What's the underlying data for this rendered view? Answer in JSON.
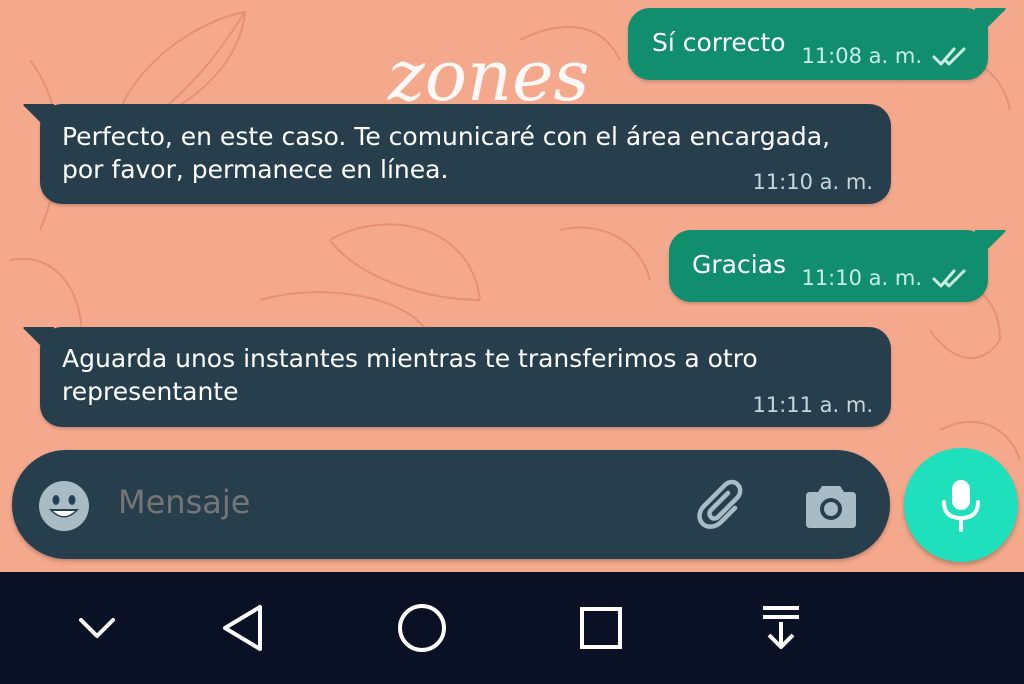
{
  "messages": [
    {
      "direction": "outgoing",
      "text": "Sí correcto",
      "time": "11:08 a. m.",
      "status": "read"
    },
    {
      "direction": "incoming",
      "text": "Perfecto, en este caso. Te comunicaré con el área encargada, por favor, permanece en línea.",
      "time": "11:10 a. m."
    },
    {
      "direction": "outgoing",
      "text": "Gracias",
      "time": "11:10 a. m.",
      "status": "read"
    },
    {
      "direction": "incoming",
      "text": "Aguarda unos instantes mientras te transferimos a otro representante",
      "time": "11:11 a. m."
    }
  ],
  "wallpaper": {
    "watermark_text": "zones"
  },
  "composer": {
    "placeholder": "Mensaje"
  },
  "icons": {
    "emoji": "emoji-icon",
    "attach": "paperclip-icon",
    "camera": "camera-icon",
    "mic": "mic-icon",
    "ticks": "double-check-icon"
  },
  "navbar": {
    "buttons": [
      "chevron-down-icon",
      "back-triangle-icon",
      "home-circle-icon",
      "recents-square-icon",
      "notification-pull-icon"
    ]
  },
  "colors": {
    "wallpaper": "#f4a98d",
    "outgoing_bubble": "#118e6e",
    "incoming_bubble": "#273f4d",
    "mic_button": "#1fe0bc",
    "navbar": "#0b1125"
  }
}
